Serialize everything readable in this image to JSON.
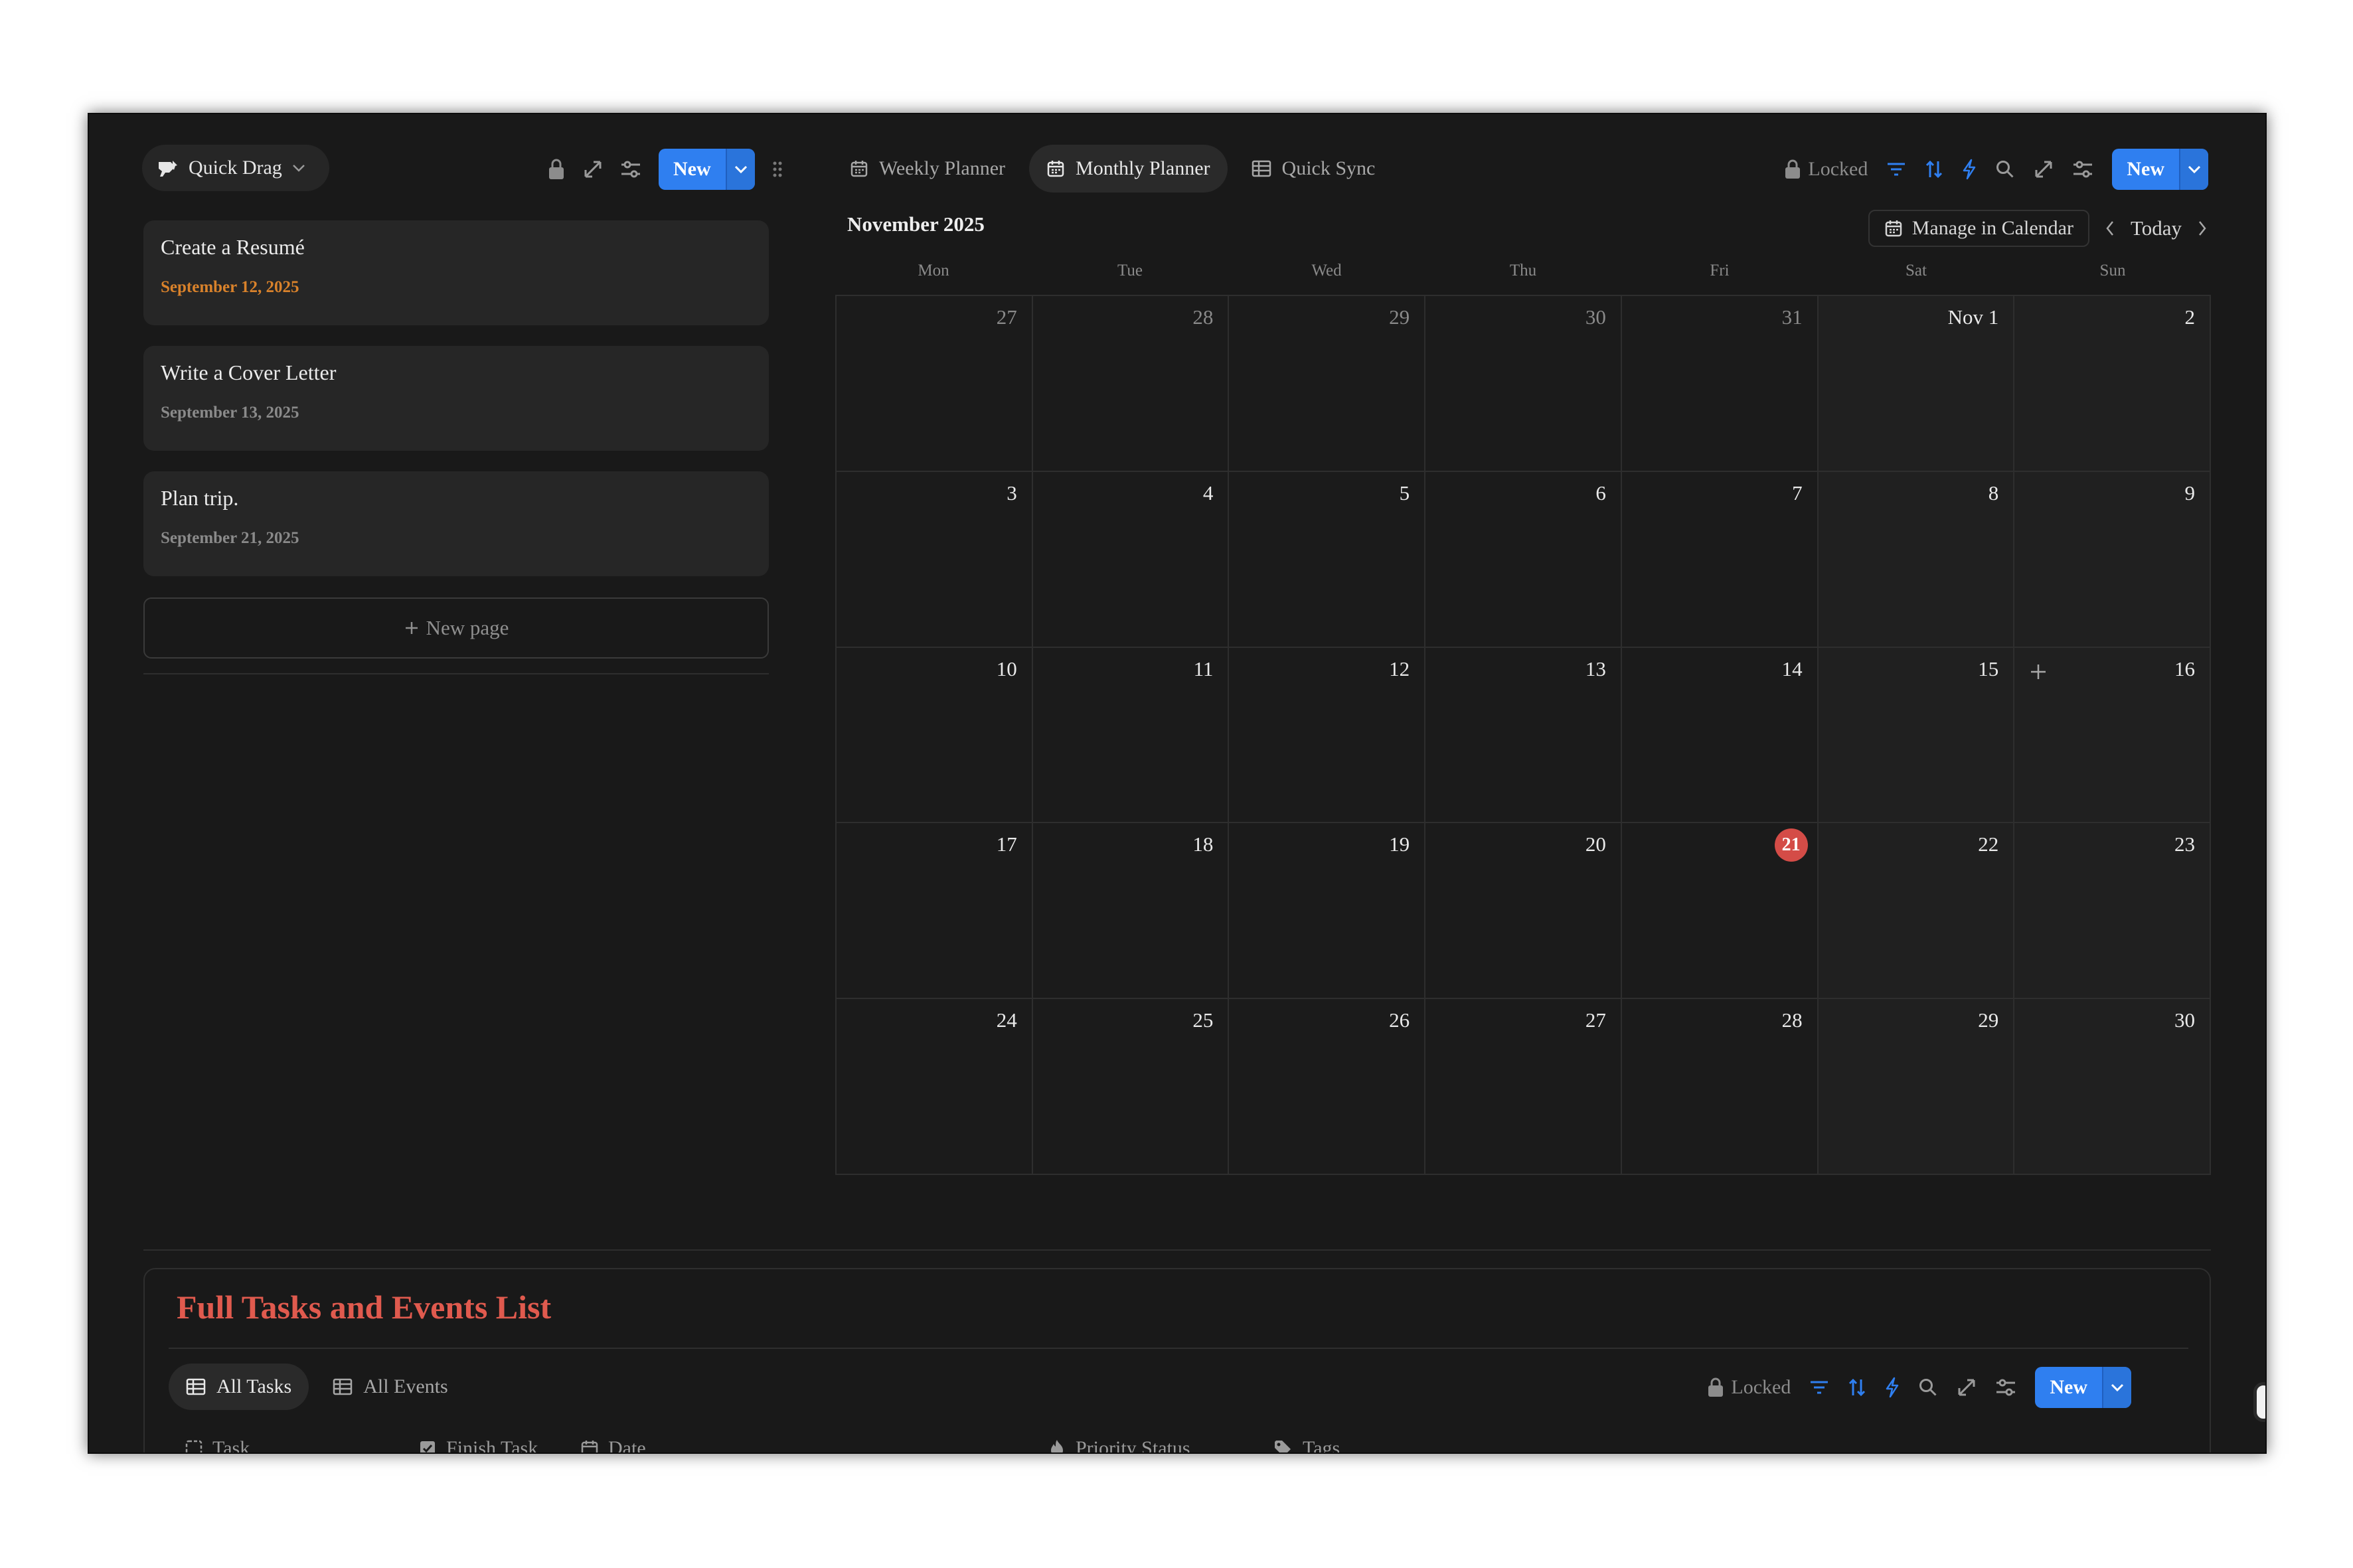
{
  "left_panel": {
    "view_switcher": "Quick Drag",
    "new_button": "New",
    "tasks": [
      {
        "title": "Create a Resumé",
        "date": "September 12, 2025",
        "highlight": true
      },
      {
        "title": "Write a Cover Letter",
        "date": "September 13, 2025",
        "highlight": false
      },
      {
        "title": "Plan trip.",
        "date": "September 21, 2025",
        "highlight": false
      }
    ],
    "new_page": "New page"
  },
  "tabs": [
    {
      "label": "Weekly Planner",
      "icon": "calendar-icon",
      "active": false
    },
    {
      "label": "Monthly Planner",
      "icon": "calendar-icon",
      "active": true
    },
    {
      "label": "Quick Sync",
      "icon": "table-icon",
      "active": false
    }
  ],
  "toolbar": {
    "locked_label": "Locked",
    "new_label": "New",
    "accent": "#2f7ff0"
  },
  "calendar": {
    "month_label": "November 2025",
    "manage_label": "Manage in Calendar",
    "today_label": "Today",
    "weekdays": [
      "Mon",
      "Tue",
      "Wed",
      "Thu",
      "Fri",
      "Sat",
      "Sun"
    ],
    "weeks": [
      [
        "27",
        "28",
        "29",
        "30",
        "31",
        "Nov 1",
        "2"
      ],
      [
        "3",
        "4",
        "5",
        "6",
        "7",
        "8",
        "9"
      ],
      [
        "10",
        "11",
        "12",
        "13",
        "14",
        "15",
        "16"
      ],
      [
        "17",
        "18",
        "19",
        "20",
        "21",
        "22",
        "23"
      ],
      [
        "24",
        "25",
        "26",
        "27",
        "28",
        "29",
        "30"
      ]
    ],
    "today_date": "21",
    "today_color": "#d44c47"
  },
  "bottom": {
    "title": "Full Tasks and Events List",
    "title_color": "#e05a4e",
    "tabs": [
      {
        "label": "All Tasks",
        "active": true
      },
      {
        "label": "All Events",
        "active": false
      }
    ],
    "locked_label": "Locked",
    "new_label": "New",
    "columns": [
      {
        "label": "Task",
        "icon": "checkbox-icon"
      },
      {
        "label": "Finish Task",
        "icon": "checked-box-icon"
      },
      {
        "label": "Date",
        "icon": "calendar-icon"
      },
      {
        "label": "Priority Status",
        "icon": "fire-icon"
      },
      {
        "label": "Tags",
        "icon": "tag-icon"
      }
    ]
  }
}
